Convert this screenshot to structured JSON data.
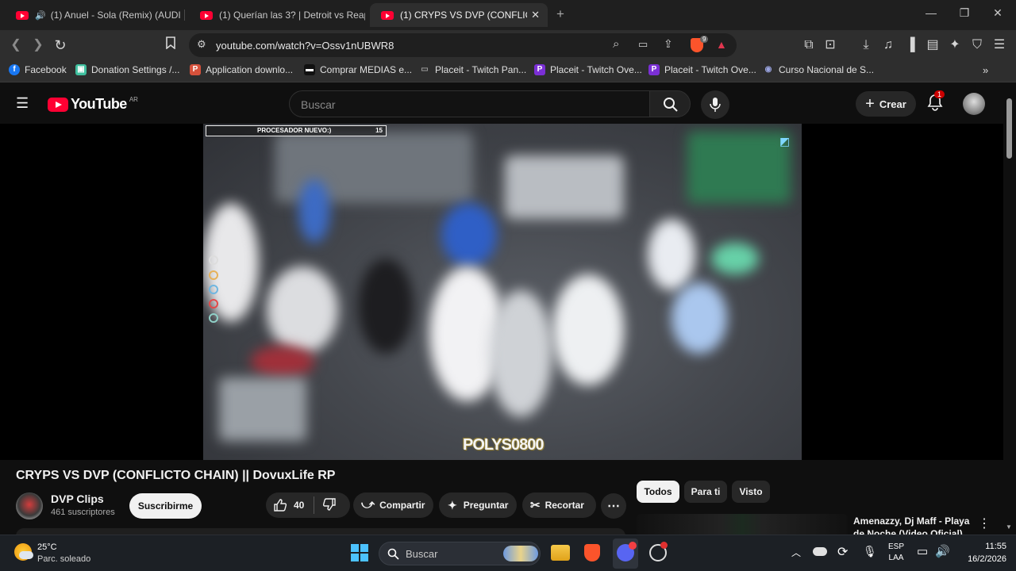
{
  "browser": {
    "tabs": [
      {
        "label": "(1) Anuel - Sola (Remix) (AUDIO) (",
        "audio": true
      },
      {
        "label": "(1) Querían las 3? | Detroit vs Reaper"
      },
      {
        "label": "(1) CRYPS VS DVP (CONFLICTO C",
        "active": true
      }
    ],
    "url": "youtube.com/watch?v=Ossv1nUBWR8",
    "brave_badge": "9",
    "bookmarks": [
      {
        "label": "Facebook",
        "color": "#1877f2",
        "glyph": "f"
      },
      {
        "label": "Donation Settings /...",
        "color": "#3fbf9e",
        "glyph": "▣"
      },
      {
        "label": "Application downlo...",
        "color": "#d6513b",
        "glyph": "P"
      },
      {
        "label": "Comprar MEDIAS e...",
        "color": "#111111",
        "glyph": "▬"
      },
      {
        "label": "Placeit - Twitch Pan...",
        "color": "#6b6b6b",
        "glyph": "▭"
      },
      {
        "label": "Placeit - Twitch Ove...",
        "color": "#7b2fd6",
        "glyph": "P"
      },
      {
        "label": "Placeit - Twitch Ove...",
        "color": "#7b2fd6",
        "glyph": "P"
      },
      {
        "label": "Curso Nacional de S...",
        "color": "#3b4a8a",
        "glyph": "◉"
      }
    ]
  },
  "youtube": {
    "logo_text": "YouTube",
    "country": "AR",
    "search_placeholder": "Buscar",
    "create_label": "Crear",
    "notif_count": "1"
  },
  "video": {
    "hud_left": "PROCESADOR NUEVO:)",
    "hud_right": "15",
    "watermark": "POLYS0800",
    "title": "CRYPS VS DVP (CONFLICTO CHAIN) || DovuxLife RP",
    "channel": "DVP Clips",
    "subscribers": "461 suscriptores",
    "subscribe_label": "Suscribirme",
    "likes": "40",
    "share_label": "Compartir",
    "ask_label": "Preguntar",
    "clip_label": "Recortar"
  },
  "sidebar": {
    "chips": [
      "Todos",
      "Para ti",
      "Visto"
    ],
    "rec_title": "Amenazzy, Dj Maff - Playa de Noche (Video Oficial)"
  },
  "taskbar": {
    "temperature": "25°C",
    "weather": "Parc. soleado",
    "search_placeholder": "Buscar",
    "lang_1": "ESP",
    "lang_2": "LAA",
    "time": "11:55",
    "date": "16/2/2026"
  }
}
